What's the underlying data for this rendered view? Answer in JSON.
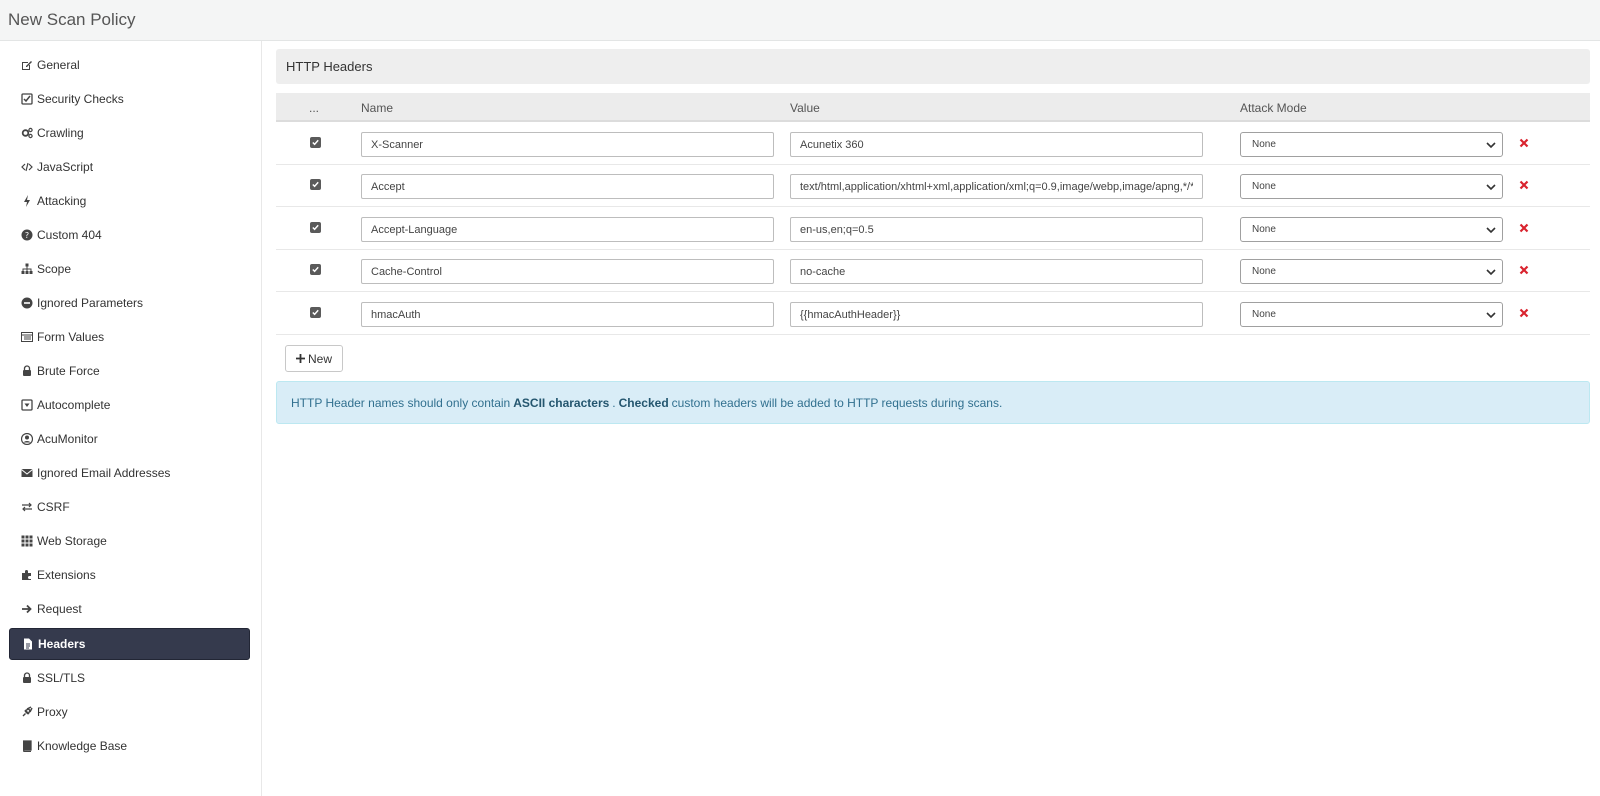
{
  "window": {
    "title": "New Scan Policy"
  },
  "sidebar": {
    "items": [
      {
        "label": "General",
        "icon": "edit-icon",
        "active": false
      },
      {
        "label": "Security Checks",
        "icon": "check-square-icon",
        "active": false
      },
      {
        "label": "Crawling",
        "icon": "cogs-icon",
        "active": false
      },
      {
        "label": "JavaScript",
        "icon": "code-icon",
        "active": false
      },
      {
        "label": "Attacking",
        "icon": "bolt-icon",
        "active": false
      },
      {
        "label": "Custom 404",
        "icon": "question-circle-icon",
        "active": false
      },
      {
        "label": "Scope",
        "icon": "sitemap-icon",
        "active": false
      },
      {
        "label": "Ignored Parameters",
        "icon": "minus-circle-icon",
        "active": false
      },
      {
        "label": "Form Values",
        "icon": "list-alt-icon",
        "active": false
      },
      {
        "label": "Brute Force",
        "icon": "lock-icon",
        "active": false
      },
      {
        "label": "Autocomplete",
        "icon": "caret-square-icon",
        "active": false
      },
      {
        "label": "AcuMonitor",
        "icon": "user-circle-icon",
        "active": false
      },
      {
        "label": "Ignored Email Addresses",
        "icon": "envelope-icon",
        "active": false
      },
      {
        "label": "CSRF",
        "icon": "exchange-icon",
        "active": false
      },
      {
        "label": "Web Storage",
        "icon": "grid-icon",
        "active": false
      },
      {
        "label": "Extensions",
        "icon": "puzzle-icon",
        "active": false
      },
      {
        "label": "Request",
        "icon": "arrow-right-icon",
        "active": false
      },
      {
        "label": "Headers",
        "icon": "file-text-icon",
        "active": true
      },
      {
        "label": "SSL/TLS",
        "icon": "lock-icon",
        "active": false
      },
      {
        "label": "Proxy",
        "icon": "plug-icon",
        "active": false
      },
      {
        "label": "Knowledge Base",
        "icon": "book-icon",
        "active": false
      }
    ]
  },
  "panel": {
    "title": "HTTP Headers"
  },
  "table": {
    "columns": {
      "check": "...",
      "name": "Name",
      "value": "Value",
      "attack_mode": "Attack Mode"
    },
    "rows": [
      {
        "checked": true,
        "name": "X-Scanner",
        "value": "Acunetix 360",
        "attack_mode": "None"
      },
      {
        "checked": true,
        "name": "Accept",
        "value": "text/html,application/xhtml+xml,application/xml;q=0.9,image/webp,image/apng,*/*;q=",
        "attack_mode": "None"
      },
      {
        "checked": true,
        "name": "Accept-Language",
        "value": "en-us,en;q=0.5",
        "attack_mode": "None"
      },
      {
        "checked": true,
        "name": "Cache-Control",
        "value": "no-cache",
        "attack_mode": "None"
      },
      {
        "checked": true,
        "name": "hmacAuth",
        "value": "{{hmacAuthHeader}}",
        "attack_mode": "None"
      }
    ]
  },
  "buttons": {
    "new_label": "New"
  },
  "info": {
    "part1": "HTTP Header names should only contain",
    "bold1": "ASCII characters",
    "part2": ".",
    "bold2": "Checked",
    "part3": "custom headers will be added to HTTP requests during scans."
  },
  "colors": {
    "active_bg": "#353a4d",
    "delete": "#d9232e",
    "info_bg": "#d9edf7"
  }
}
